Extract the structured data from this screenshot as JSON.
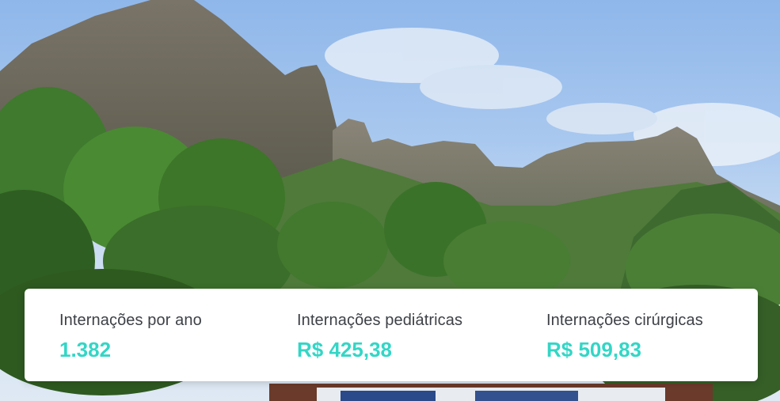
{
  "background": {
    "description_icon": "mountain-landscape-photo"
  },
  "stats": [
    {
      "label": "Internações por ano",
      "value": "1.382"
    },
    {
      "label": "Internações pediátricas",
      "value": "R$ 425,38"
    },
    {
      "label": "Internações cirúrgicas",
      "value": "R$ 509,83"
    }
  ],
  "colors": {
    "accent": "#33d6c6",
    "label": "#3d4147",
    "card": "#ffffff"
  }
}
